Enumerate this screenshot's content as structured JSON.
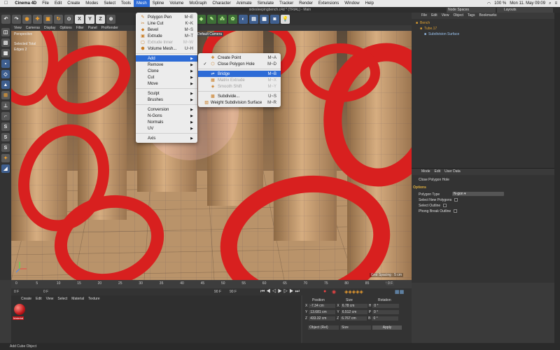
{
  "menubar": {
    "apple": "",
    "app": "Cinema 4D",
    "items": [
      "File",
      "Edit",
      "Create",
      "Modes",
      "Select",
      "Tools",
      "Mesh",
      "Spline",
      "Volume",
      "MoGraph",
      "Character",
      "Animate",
      "Simulate",
      "Tracker",
      "Render",
      "Extensions",
      "Window",
      "Help"
    ],
    "active": "Mesh",
    "battery": "100 %",
    "clock": "Mon 11. May  09:09"
  },
  "window_title": "sidesleepingbench.c4d * (TRIAL) - Main",
  "node_spaces": "Node Spaces",
  "layouts": "Layouts",
  "viewport": {
    "menu": [
      "View",
      "Cameras",
      "Display",
      "Options",
      "Filter",
      "Panel",
      "ProRender"
    ],
    "label": "Perspective",
    "camera": "Default Camera",
    "selected": "Selected Total",
    "edges": "Edges",
    "edges_count": "2",
    "grid_spacing": "Grid Spacing : 5 cm"
  },
  "mesh_menu": {
    "items": [
      {
        "label": "Polygon Pen",
        "shortcut": "M~E",
        "icon": "polygon-pen-icon"
      },
      {
        "label": "Line Cut",
        "shortcut": "K~K",
        "icon": "line-cut-icon"
      },
      {
        "label": "Bevel",
        "shortcut": "M~S",
        "icon": "bevel-icon"
      },
      {
        "label": "Extrude",
        "shortcut": "M~T",
        "icon": "extrude-icon"
      },
      {
        "label": "Extrude Inner",
        "shortcut": "M~W",
        "icon": "extrude-inner-icon",
        "disabled": true
      },
      {
        "label": "Volume Mesh...",
        "shortcut": "U~H",
        "icon": "volume-mesh-icon"
      }
    ],
    "submenus": [
      "Add",
      "Remove",
      "Clone",
      "Cut",
      "Move"
    ],
    "submenus2": [
      "Sculpt",
      "Brushes"
    ],
    "submenus3": [
      "Conversion",
      "N-Gons",
      "Normals",
      "UV"
    ],
    "submenus4": [
      "Axis"
    ]
  },
  "add_menu": {
    "items": [
      {
        "label": "Create Point",
        "shortcut": "M~A"
      },
      {
        "label": "Close Polygon Hole",
        "shortcut": "M~D",
        "checked": true
      },
      {
        "label": "Bridge",
        "shortcut": "M~B",
        "highlight": true
      },
      {
        "label": "Matrix Extrude",
        "shortcut": "M~X",
        "disabled": true
      },
      {
        "label": "Smooth Shift",
        "shortcut": "M~Y",
        "disabled": true
      },
      {
        "label": "Subdivide...",
        "shortcut": "U~S"
      },
      {
        "label": "Weight Subdivision Surface",
        "shortcut": "M~R"
      }
    ]
  },
  "object_manager": {
    "menu": [
      "File",
      "Edit",
      "View",
      "Object",
      "Tags",
      "Bookmarks"
    ],
    "objects": [
      {
        "name": "Bench",
        "color": "#e0a030"
      },
      {
        "name": "Tube.17",
        "color": "#e0a030"
      },
      {
        "name": "Subdivision Surface",
        "color": "#9bc4f0"
      }
    ]
  },
  "attributes": {
    "menu": [
      "Mode",
      "Edit",
      "User Data"
    ],
    "title": "Close Polygon Hole",
    "tab": "Options",
    "polygon_type_label": "Polygon Type",
    "polygon_type_value": "N-gon",
    "select_new": "Select New Polygons",
    "select_outline": "Select Outline",
    "phong_break": "Phong Break Outline"
  },
  "timeline": {
    "ticks": [
      "0",
      "5",
      "10",
      "15",
      "20",
      "25",
      "30",
      "35",
      "40",
      "45",
      "50",
      "55",
      "60",
      "65",
      "70",
      "75",
      "80",
      "85",
      "90"
    ],
    "start": "0 F",
    "cur": "0 F",
    "end1": "90 F",
    "end2": "90 F",
    "frame_display": "0 F"
  },
  "material_manager": {
    "menu": [
      "Create",
      "Edit",
      "View",
      "Select",
      "Material",
      "Texture"
    ],
    "material_name": "Material"
  },
  "coordinates": {
    "headers": [
      "Position",
      "Size",
      "Rotation"
    ],
    "rows": [
      {
        "axis": "X",
        "pos": "-7.34 cm",
        "size": "6.78 cm",
        "raxis": "H",
        "rot": "0 °"
      },
      {
        "axis": "Y",
        "pos": "13.681 cm",
        "size": "6.512 cm",
        "raxis": "P",
        "rot": "0 °"
      },
      {
        "axis": "Z",
        "pos": "433.32 cm",
        "size": "6.767 cm",
        "raxis": "B",
        "rot": "0 °"
      }
    ],
    "mode": "Object (Rel)",
    "size_mode": "Size",
    "apply": "Apply"
  },
  "status": "Add Cube Object",
  "colors": {
    "accent": "#2d6bd6",
    "red": "#d8201f",
    "tube": "#c89a6a"
  }
}
